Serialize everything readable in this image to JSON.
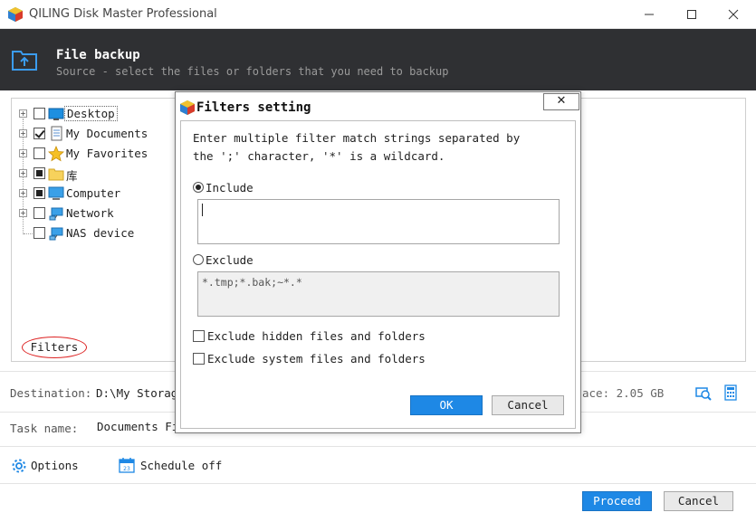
{
  "window": {
    "title": "QILING Disk Master Professional",
    "minimize": "—",
    "maximize": "☐",
    "close": "✕"
  },
  "header": {
    "title": "File backup",
    "subtitle": "Source - select the files or folders that you need to backup"
  },
  "tree": {
    "items": [
      {
        "label": "Desktop",
        "state": "unchecked",
        "icon": "desktop-icon"
      },
      {
        "label": "My Documents",
        "state": "checked",
        "icon": "documents-icon"
      },
      {
        "label": "My Favorites",
        "state": "unchecked",
        "icon": "favorites-star-icon"
      },
      {
        "label": "库",
        "state": "partial",
        "icon": "library-folder-icon"
      },
      {
        "label": "Computer",
        "state": "partial",
        "icon": "computer-icon"
      },
      {
        "label": "Network",
        "state": "unchecked",
        "icon": "network-icon"
      },
      {
        "label": "NAS device",
        "state": "unchecked",
        "icon": "nas-icon"
      }
    ],
    "expand_glyph": "+"
  },
  "filters_link": "Filters",
  "destination": {
    "label": "Destination:",
    "value": "D:\\My Storag",
    "space_suffix": "ace: 2.05 GB"
  },
  "task": {
    "label": "Task name:",
    "value": "Documents Fi"
  },
  "bottom": {
    "options_label": "Options",
    "schedule_label": "Schedule off",
    "proceed_label": "Proceed",
    "cancel_label": "Cancel"
  },
  "dialog": {
    "title": "Filters setting",
    "close_glyph": "✕",
    "instructions_line1": "Enter multiple filter match strings separated by",
    "instructions_line2": "the ';' character, '*' is a wildcard.",
    "include_label": "Include",
    "include_value": "",
    "exclude_label": "Exclude",
    "exclude_value": "*.tmp;*.bak;~*.*",
    "exclude_hidden_label": "Exclude hidden files and folders",
    "exclude_system_label": "Exclude system files and folders",
    "ok_label": "OK",
    "cancel_label": "Cancel"
  },
  "colors": {
    "header_bg": "#2f3033",
    "accent_blue": "#1e88e5",
    "filters_ring": "#dd2222"
  }
}
